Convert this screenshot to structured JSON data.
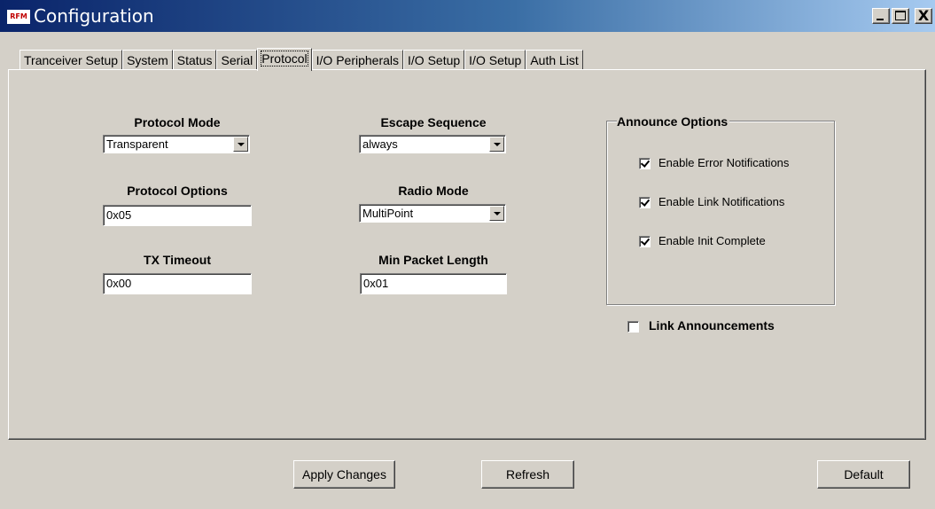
{
  "window": {
    "title": "Configuration",
    "icon_text": "RFM",
    "min_label": "_",
    "max_label": "□",
    "close_label": "X"
  },
  "tabs": [
    {
      "label": "Tranceiver Setup"
    },
    {
      "label": "System"
    },
    {
      "label": "Status"
    },
    {
      "label": "Serial"
    },
    {
      "label": "Protocol",
      "active": true
    },
    {
      "label": "I/O Peripherals"
    },
    {
      "label": "I/O Setup"
    },
    {
      "label": "I/O Setup"
    },
    {
      "label": "Auth List"
    }
  ],
  "protocol": {
    "protocol_mode": {
      "label": "Protocol Mode",
      "value": "Transparent"
    },
    "protocol_options": {
      "label": "Protocol Options",
      "value": "0x05"
    },
    "tx_timeout": {
      "label": "TX Timeout",
      "value": "0x00"
    },
    "escape_sequence": {
      "label": "Escape Sequence",
      "value": "always"
    },
    "radio_mode": {
      "label": "Radio Mode",
      "value": "MultiPoint"
    },
    "min_packet_length": {
      "label": "Min Packet Length",
      "value": "0x01"
    }
  },
  "announce": {
    "title": "Announce Options",
    "options": [
      {
        "label": "Enable Error Notifications",
        "checked": true
      },
      {
        "label": "Enable Link Notifications",
        "checked": true
      },
      {
        "label": "Enable Init Complete",
        "checked": true
      }
    ]
  },
  "link_announcements": {
    "label": "Link Announcements",
    "checked": false
  },
  "buttons": {
    "apply": "Apply Changes",
    "refresh": "Refresh",
    "default": "Default"
  }
}
